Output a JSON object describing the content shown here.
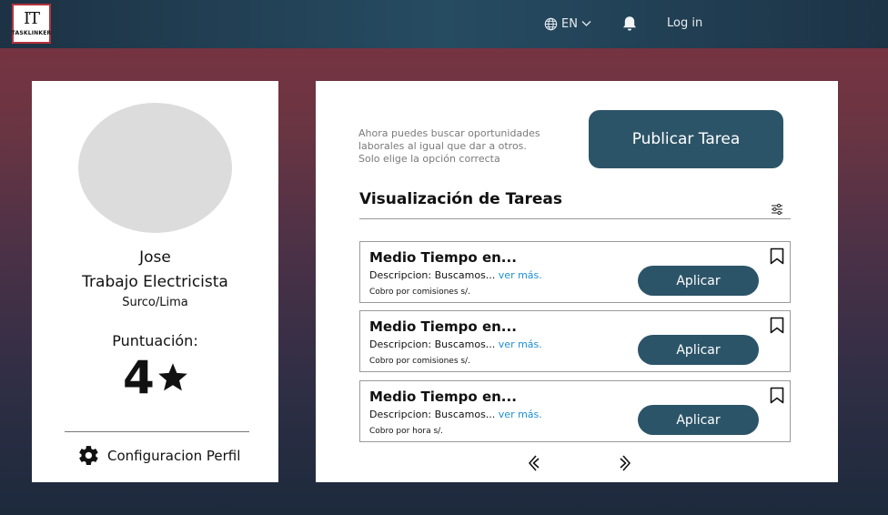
{
  "header": {
    "logo_mark": "IT",
    "logo_text": "TASKLINKER",
    "language": "EN",
    "language_icon": "globe-icon",
    "notification_icon": "bell-icon",
    "login_label": "Log in"
  },
  "profile": {
    "name": "Jose",
    "job": "Trabajo Electricista",
    "location": "Surco/Lima",
    "score_label": "Puntuación:",
    "score": "4",
    "score_icon": "star-icon",
    "config_label": "Configuracion Perfil",
    "config_icon": "gear-icon"
  },
  "main": {
    "promo_lines": [
      "Ahora puedes buscar oportunidades",
      "laborales al igual que dar a otros.",
      "Solo elige la opción correcta"
    ],
    "publish_label": "Publicar Tarea",
    "tasks_title": "Visualización de Tareas",
    "filter_icon": "sliders-icon",
    "tasks": [
      {
        "title": "Medio Tiempo en...",
        "desc": "Descripcion: Buscamos...",
        "more": "ver más.",
        "pay": "Cobro por comisiones s/.",
        "apply": "Aplicar"
      },
      {
        "title": "Medio Tiempo en...",
        "desc": "Descripcion: Buscamos...",
        "more": "ver más.",
        "pay": "Cobro por comisiones s/.",
        "apply": "Aplicar"
      },
      {
        "title": "Medio Tiempo en...",
        "desc": "Descripcion: Buscamos...",
        "more": "ver más.",
        "pay": "Cobro por hora s/.",
        "apply": "Aplicar"
      }
    ],
    "pager": {
      "prev_icon": "chevron-double-left-icon",
      "next_icon": "chevron-double-right-icon"
    }
  },
  "colors": {
    "accent": "#2c5468",
    "link": "#1a8fd6",
    "header": "#264c62",
    "background_top": "#7d3240",
    "background_bottom": "#1c2a3c"
  }
}
